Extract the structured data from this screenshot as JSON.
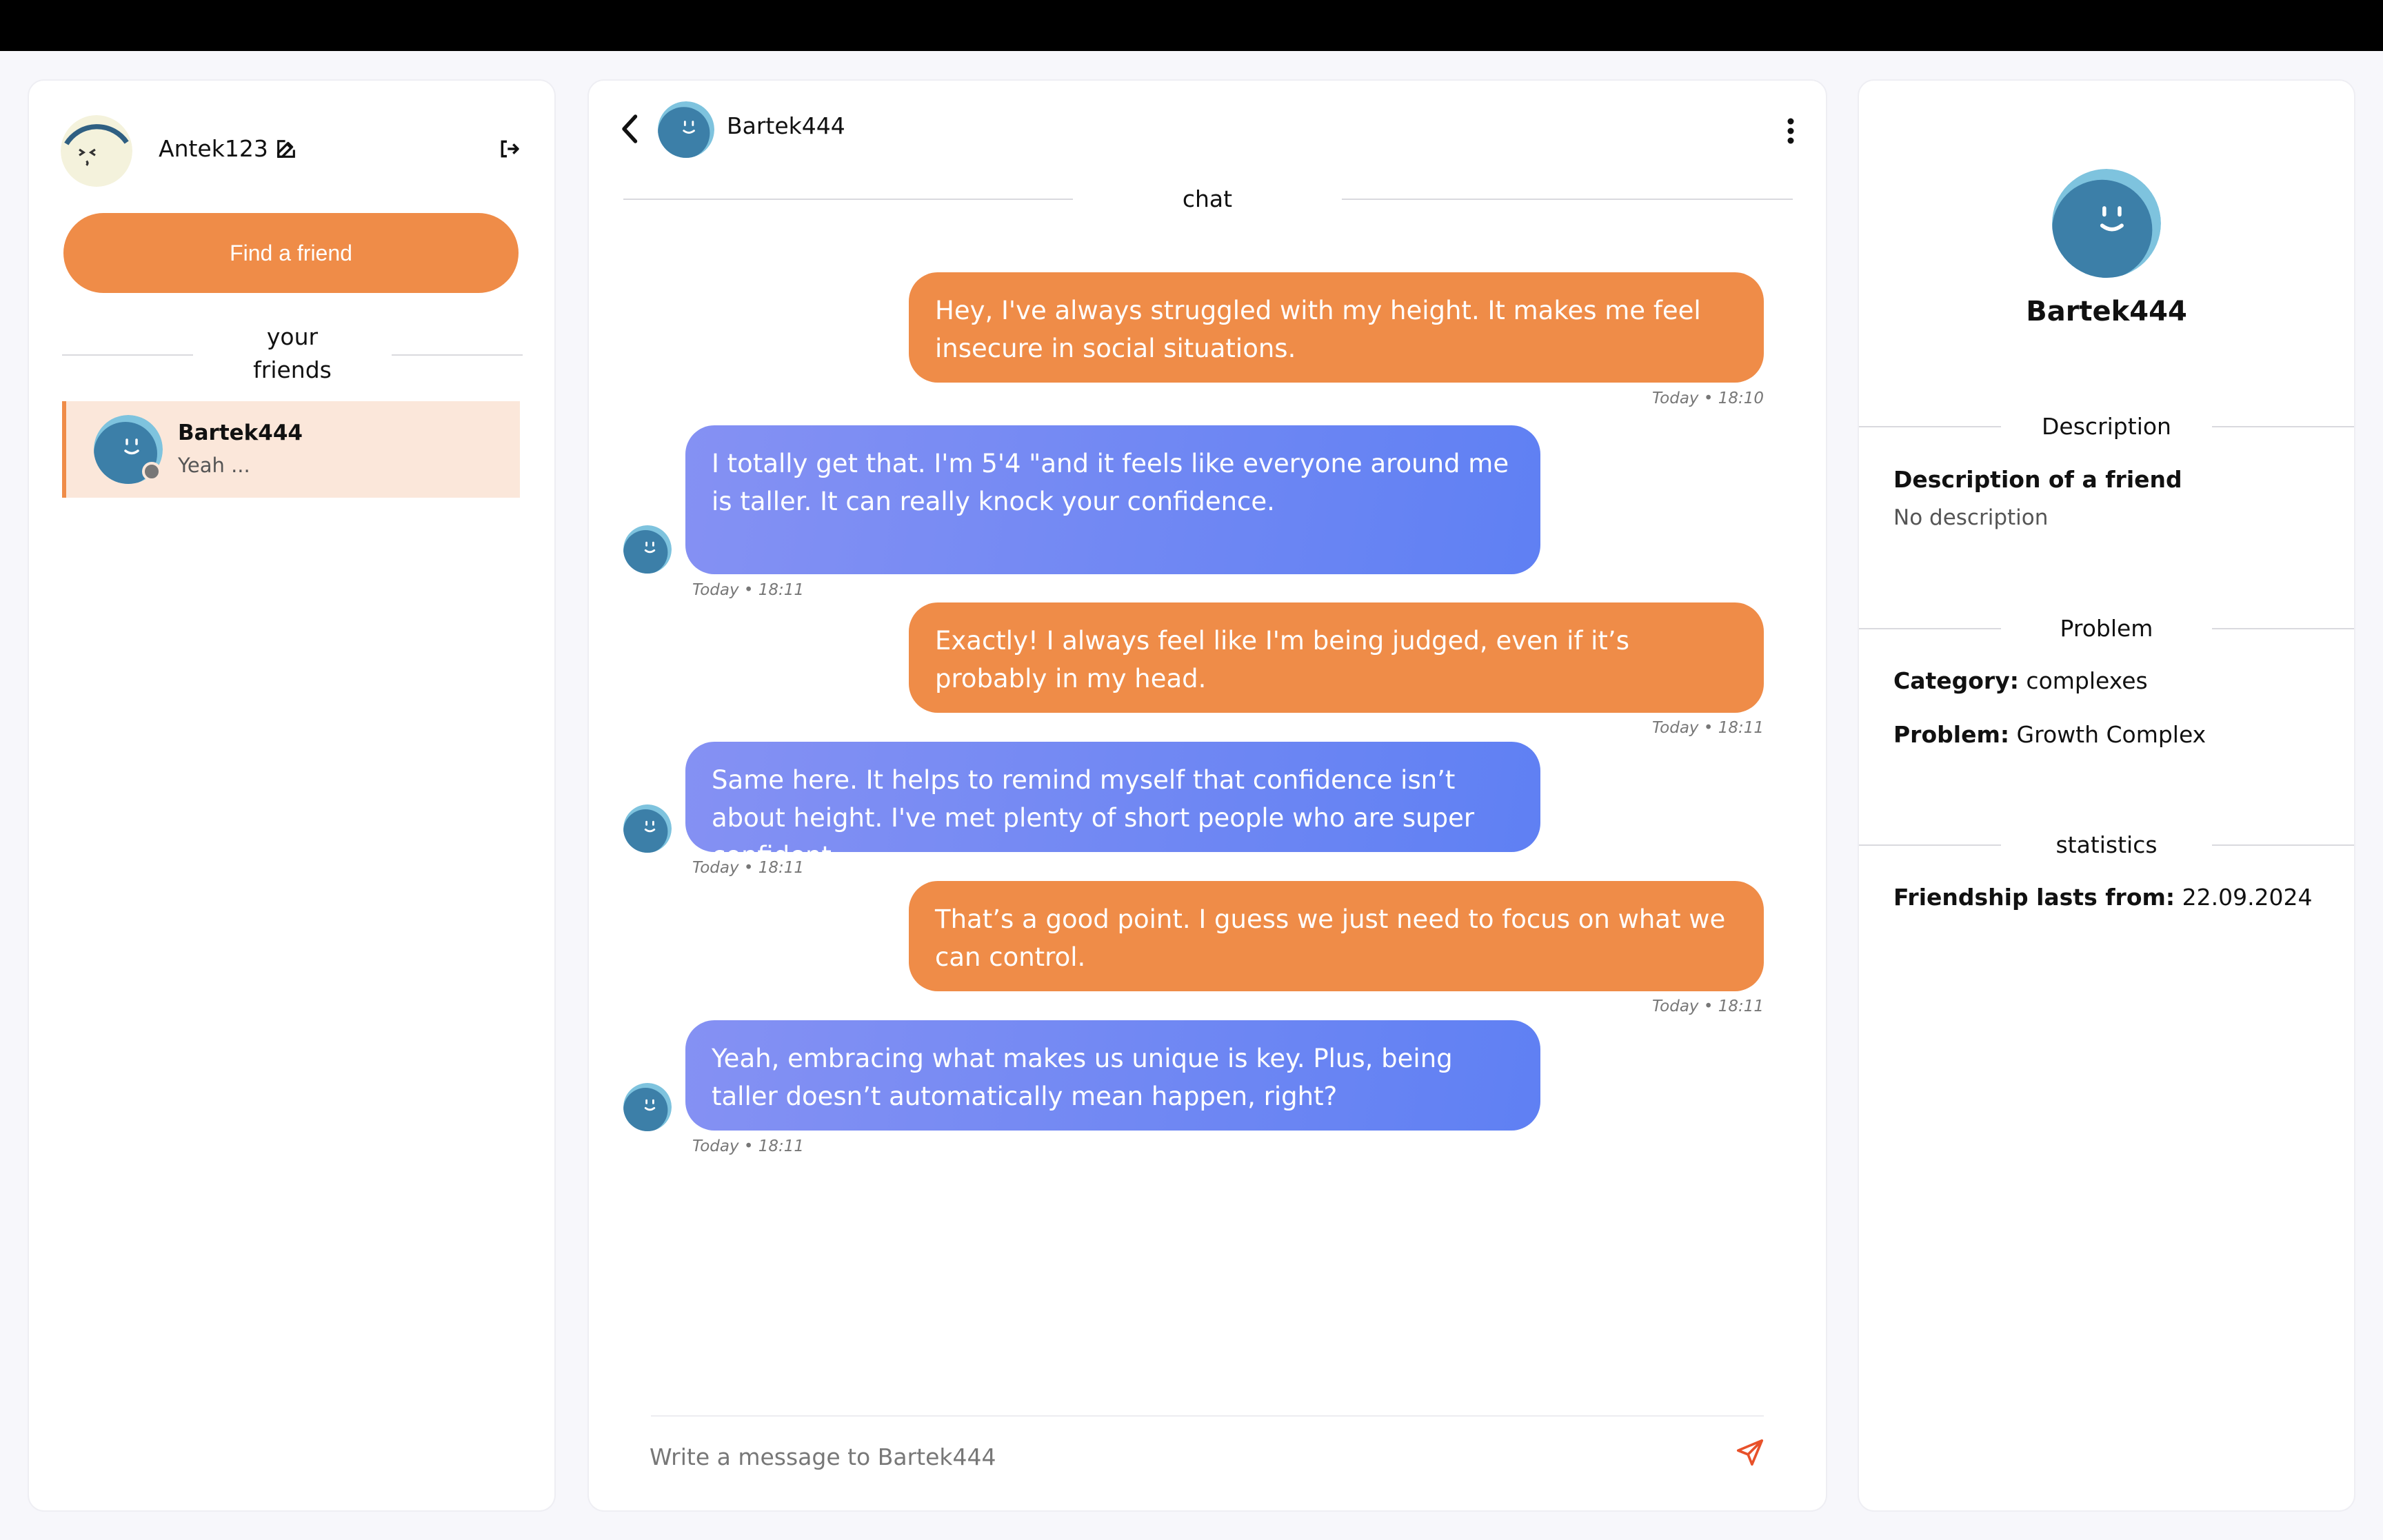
{
  "user": {
    "name": "Antek123"
  },
  "sidebar": {
    "find_button": "Find a friend",
    "friends_title_line1": "your",
    "friends_title_line2": "friends",
    "friends": [
      {
        "name": "Bartek444",
        "preview": "Yeah ..."
      }
    ]
  },
  "chat": {
    "friend_name": "Bartek444",
    "section_title": "chat",
    "messages": [
      {
        "dir": "out",
        "text": "Hey, I've always struggled with my height. It makes me feel insecure in social situations.",
        "time": "Today • 18:10"
      },
      {
        "dir": "in",
        "text": "I totally get that. I'm 5'4 \"and it feels like everyone around me is taller. It can really knock your confidence.",
        "time": "Today • 18:11"
      },
      {
        "dir": "out",
        "text": "Exactly! I always feel like I'm being judged, even if it’s probably in my head.",
        "time": "Today • 18:11"
      },
      {
        "dir": "in",
        "text": "Same here. It helps to remind myself that confidence isn’t about height. I've met plenty of short people who are super confident.",
        "time": "Today • 18:11"
      },
      {
        "dir": "out",
        "text": "That’s a good point. I guess we just need to focus on what we can control.",
        "time": "Today • 18:11"
      },
      {
        "dir": "in",
        "text": "Yeah, embracing what makes us unique is key. Plus, being taller doesn’t automatically mean happen, right?",
        "time": "Today • 18:11"
      }
    ],
    "composer_placeholder": "Write a message to Bartek444"
  },
  "profile": {
    "name": "Bartek444",
    "description_title": "Description",
    "description_label": "Description of a friend",
    "description_value": "No description",
    "problem_title": "Problem",
    "category_label": "Category:",
    "category_value": "complexes",
    "problem_label": "Problem:",
    "problem_value": "Growth Complex",
    "statistics_title": "statistics",
    "friendship_label": "Friendship lasts from:",
    "friendship_value": "22.09.2024"
  },
  "icons": {
    "edit": "edit-icon",
    "logout": "logout-icon",
    "back": "chevron-left-icon",
    "more": "more-vertical-icon",
    "send": "send-icon"
  },
  "colors": {
    "accent": "#ef8c48",
    "incoming_start": "#8591f3",
    "incoming_end": "#5f80f3",
    "selected_bg": "#fbe7da",
    "avatar_blue": "#3c7fa8",
    "avatar_light": "#7ec3de"
  }
}
